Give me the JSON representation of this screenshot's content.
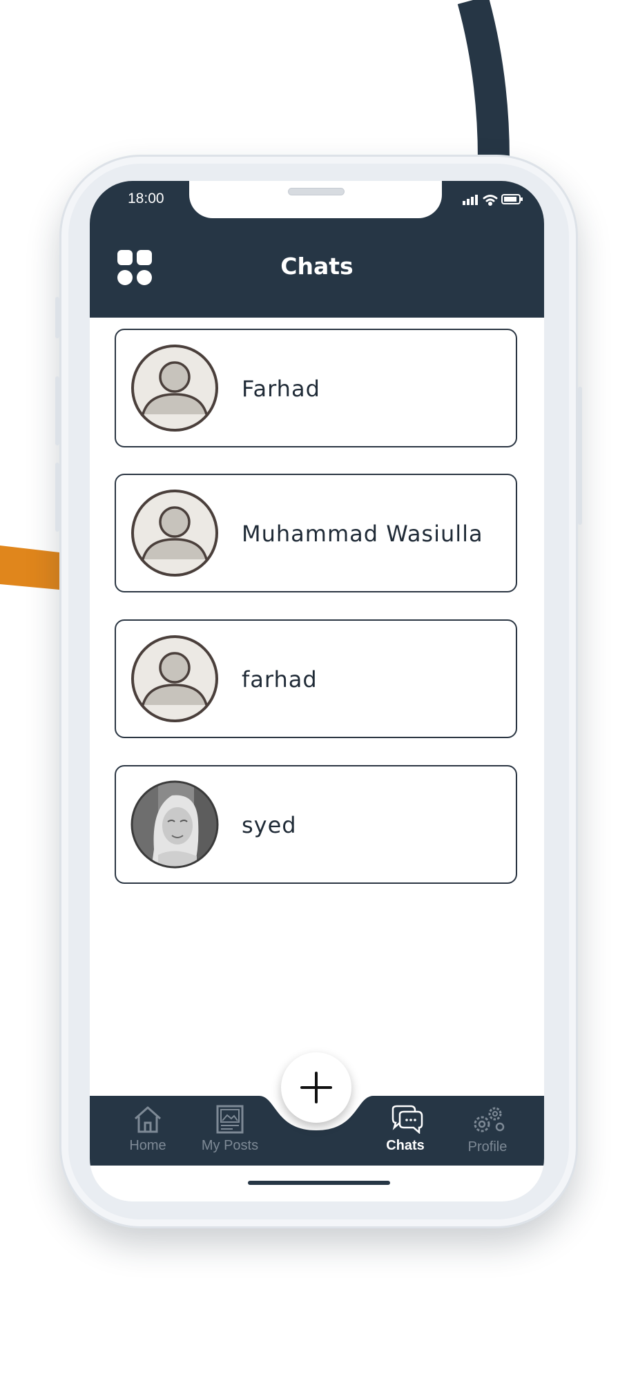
{
  "status_bar": {
    "time": "18:00"
  },
  "header": {
    "title": "Chats",
    "menu_icon": "grid-menu-icon"
  },
  "chats": [
    {
      "name": "Farhad",
      "avatar": "default-avatar"
    },
    {
      "name": "Muhammad Wasiulla",
      "avatar": "default-avatar"
    },
    {
      "name": "farhad",
      "avatar": "default-avatar"
    },
    {
      "name": "syed",
      "avatar": "photo-avatar"
    }
  ],
  "fab": {
    "icon": "plus-icon"
  },
  "bottom_nav": {
    "items": [
      {
        "label": "Home",
        "icon": "home-icon",
        "active": false
      },
      {
        "label": "My Posts",
        "icon": "posts-icon",
        "active": false
      },
      {
        "label": "Chats",
        "icon": "chat-bubbles-icon",
        "active": true
      },
      {
        "label": "Profile",
        "icon": "gears-icon",
        "active": false
      }
    ]
  },
  "colors": {
    "primary": "#263645",
    "accent_stripe": "#e0861c",
    "nav_inactive": "#7e8a96",
    "card_border": "#2a3542"
  }
}
